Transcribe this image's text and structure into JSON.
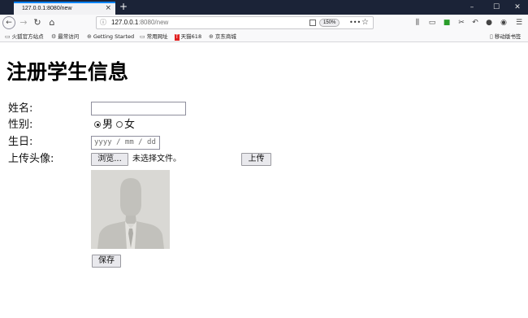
{
  "browser": {
    "tab_title": "127.0.0.1:8080/new",
    "tab_close": "×",
    "new_tab": "+",
    "window_controls": {
      "minimize": "–",
      "maximize": "☐",
      "close": "✕"
    },
    "url_host": "127.0.0.1",
    "url_rest": ":8080/new",
    "zoom": "150%",
    "more": "•••",
    "bookmarks": [
      {
        "label": "火狐官方站点",
        "icon": "folder-icon"
      },
      {
        "label": "最常访问",
        "icon": "gear-icon"
      },
      {
        "label": "Getting Started",
        "icon": "globe-icon"
      },
      {
        "label": "常用网址",
        "icon": "folder-icon"
      },
      {
        "label": "天猫618",
        "icon": "tmall-icon"
      },
      {
        "label": "京东商城",
        "icon": "globe-icon"
      }
    ],
    "mobile_bookmarks": "移动版书签"
  },
  "page": {
    "title": "注册学生信息",
    "labels": {
      "name": "姓名:",
      "gender": "性别:",
      "birthday": "生日:",
      "avatar": "上传头像:"
    },
    "gender_options": [
      {
        "label": "男",
        "checked": true
      },
      {
        "label": "女",
        "checked": false
      }
    ],
    "date_placeholder": "yyyy / mm / dd",
    "browse_button": "浏览...",
    "file_status": "未选择文件。",
    "upload_button": "上传",
    "save_button": "保存"
  }
}
